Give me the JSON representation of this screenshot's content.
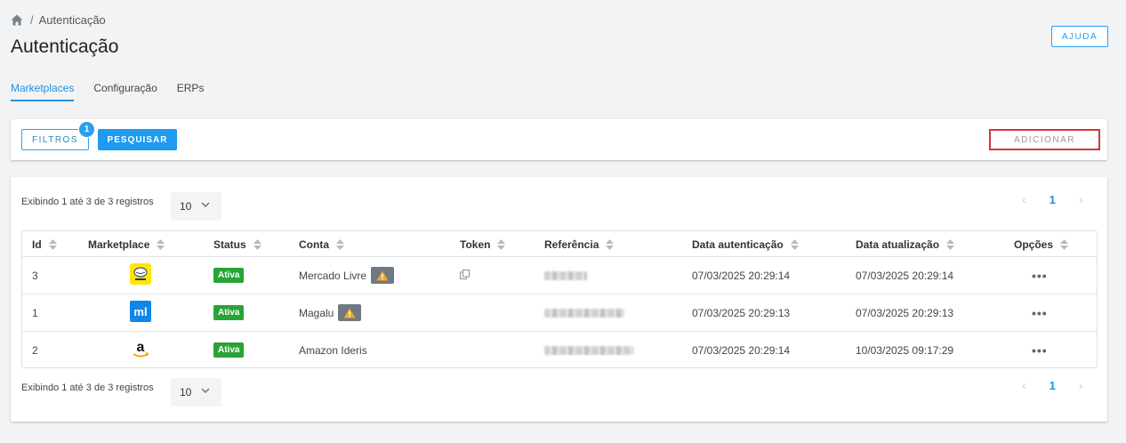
{
  "breadcrumb": {
    "current": "Autenticação",
    "separator": "/"
  },
  "page": {
    "title": "Autenticação",
    "help_label": "AJUDA"
  },
  "tabs": [
    {
      "label": "Marketplaces",
      "active": true
    },
    {
      "label": "Configuração",
      "active": false
    },
    {
      "label": "ERPs",
      "active": false
    }
  ],
  "toolbar": {
    "filters_label": "FILTROS",
    "filters_count": "1",
    "search_label": "PESQUISAR",
    "add_label": "ADICIONAR"
  },
  "pagination": {
    "showing_top": "Exibindo 1 até 3 de 3 registros",
    "showing_bottom": "Exibindo 1 até 3 de 3 registros",
    "page_size": "10",
    "current_page": "1",
    "prev_icon": "chevron-left-icon",
    "next_icon": "chevron-right-icon"
  },
  "table": {
    "headers": [
      "Id",
      "Marketplace",
      "Status",
      "Conta",
      "Token",
      "Referência",
      "Data autenticação",
      "Data atualização",
      "Opções"
    ],
    "rows": [
      {
        "id": "3",
        "marketplace": "mercado-livre-logo",
        "status": "Ativa",
        "conta": "Mercado Livre",
        "warning": true,
        "token_copy": true,
        "data_autenticacao": "07/03/2025 20:29:14",
        "data_atualizacao": "07/03/2025 20:29:14",
        "options": "•••"
      },
      {
        "id": "1",
        "marketplace": "magalu-logo",
        "status": "Ativa",
        "conta": "Magalu",
        "warning": true,
        "token_copy": false,
        "data_autenticacao": "07/03/2025 20:29:13",
        "data_atualizacao": "07/03/2025 20:29:13",
        "options": "•••"
      },
      {
        "id": "2",
        "marketplace": "amazon-logo",
        "status": "Ativa",
        "conta": "Amazon Ideris",
        "warning": false,
        "token_copy": false,
        "data_autenticacao": "07/03/2025 20:29:14",
        "data_atualizacao": "10/03/2025 09:17:29",
        "options": "•••"
      }
    ]
  },
  "colors": {
    "accent": "#1e9bf0",
    "status_active": "#2aa336",
    "warning_bg": "#6e7983",
    "warning_icon": "#f5a623",
    "highlight_border": "#d8343a"
  }
}
